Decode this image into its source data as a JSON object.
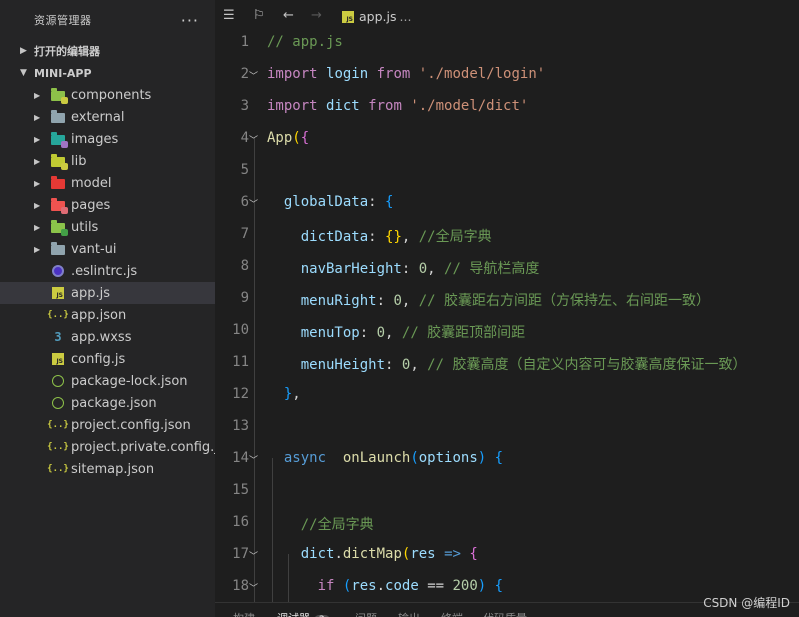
{
  "sidebar": {
    "title": "资源管理器",
    "more": "···",
    "open_editors": "打开的编辑器",
    "project": "MINI-APP",
    "items": [
      {
        "label": "components",
        "type": "folder",
        "color": "#8dc149",
        "dot": "#cbcb41"
      },
      {
        "label": "external",
        "type": "folder",
        "color": "#90a4ae",
        "dot": ""
      },
      {
        "label": "images",
        "type": "folder",
        "color": "#26a69a",
        "dot": "#a074c4"
      },
      {
        "label": "lib",
        "type": "folder",
        "color": "#c0ca33",
        "dot": "#cbcb41"
      },
      {
        "label": "model",
        "type": "folder",
        "color": "#e53935",
        "dot": ""
      },
      {
        "label": "pages",
        "type": "folder",
        "color": "#ef5350",
        "dot": "#e06c75"
      },
      {
        "label": "utils",
        "type": "folder",
        "color": "#8bc34a",
        "dot": "#43a047"
      },
      {
        "label": "vant-ui",
        "type": "folder",
        "color": "#90a4ae",
        "dot": ""
      },
      {
        "label": ".eslintrc.js",
        "type": "eslint"
      },
      {
        "label": "app.js",
        "type": "js",
        "selected": true
      },
      {
        "label": "app.json",
        "type": "json"
      },
      {
        "label": "app.wxss",
        "type": "wxss"
      },
      {
        "label": "config.js",
        "type": "js"
      },
      {
        "label": "package-lock.json",
        "type": "npm"
      },
      {
        "label": "package.json",
        "type": "npm"
      },
      {
        "label": "project.config.json",
        "type": "json"
      },
      {
        "label": "project.private.config.js...",
        "type": "json"
      },
      {
        "label": "sitemap.json",
        "type": "json"
      }
    ]
  },
  "breadcrumb": {
    "file": "app.js",
    "ellipsis": "..."
  },
  "code_lines": [
    {
      "n": "1",
      "fold": false,
      "tokens": [
        [
          "t-cmt",
          "// app.js"
        ]
      ]
    },
    {
      "n": "2",
      "fold": true,
      "tokens": [
        [
          "t-kw2",
          "import"
        ],
        [
          "t-pun",
          " "
        ],
        [
          "t-var",
          "login"
        ],
        [
          "t-pun",
          " "
        ],
        [
          "t-kw2",
          "from"
        ],
        [
          "t-pun",
          " "
        ],
        [
          "t-str",
          "'./model/login'"
        ]
      ]
    },
    {
      "n": "3",
      "fold": false,
      "tokens": [
        [
          "t-kw2",
          "import"
        ],
        [
          "t-pun",
          " "
        ],
        [
          "t-var",
          "dict"
        ],
        [
          "t-pun",
          " "
        ],
        [
          "t-kw2",
          "from"
        ],
        [
          "t-pun",
          " "
        ],
        [
          "t-str",
          "'./model/dict'"
        ]
      ]
    },
    {
      "n": "4",
      "fold": true,
      "tokens": [
        [
          "t-fn",
          "App"
        ],
        [
          "t-brk1",
          "("
        ],
        [
          "t-brk2",
          "{"
        ]
      ]
    },
    {
      "n": "5",
      "fold": false,
      "tokens": []
    },
    {
      "n": "6",
      "fold": true,
      "tokens": [
        [
          "t-pun",
          "  "
        ],
        [
          "t-var",
          "globalData"
        ],
        [
          "t-pun",
          ": "
        ],
        [
          "t-brk3",
          "{"
        ]
      ]
    },
    {
      "n": "7",
      "fold": false,
      "tokens": [
        [
          "t-pun",
          "    "
        ],
        [
          "t-var",
          "dictData"
        ],
        [
          "t-pun",
          ": "
        ],
        [
          "t-brk1",
          "{}"
        ],
        [
          "t-pun",
          ", "
        ],
        [
          "t-cmt",
          "//全局字典"
        ]
      ]
    },
    {
      "n": "8",
      "fold": false,
      "tokens": [
        [
          "t-pun",
          "    "
        ],
        [
          "t-var",
          "navBarHeight"
        ],
        [
          "t-pun",
          ": "
        ],
        [
          "t-num",
          "0"
        ],
        [
          "t-pun",
          ", "
        ],
        [
          "t-cmt",
          "// 导航栏高度"
        ]
      ]
    },
    {
      "n": "9",
      "fold": false,
      "tokens": [
        [
          "t-pun",
          "    "
        ],
        [
          "t-var",
          "menuRight"
        ],
        [
          "t-pun",
          ": "
        ],
        [
          "t-num",
          "0"
        ],
        [
          "t-pun",
          ", "
        ],
        [
          "t-cmt",
          "// 胶囊距右方间距（方保持左、右间距一致）"
        ]
      ]
    },
    {
      "n": "10",
      "fold": false,
      "tokens": [
        [
          "t-pun",
          "    "
        ],
        [
          "t-var",
          "menuTop"
        ],
        [
          "t-pun",
          ": "
        ],
        [
          "t-num",
          "0"
        ],
        [
          "t-pun",
          ", "
        ],
        [
          "t-cmt",
          "// 胶囊距顶部间距"
        ]
      ]
    },
    {
      "n": "11",
      "fold": false,
      "tokens": [
        [
          "t-pun",
          "    "
        ],
        [
          "t-var",
          "menuHeight"
        ],
        [
          "t-pun",
          ": "
        ],
        [
          "t-num",
          "0"
        ],
        [
          "t-pun",
          ", "
        ],
        [
          "t-cmt",
          "// 胶囊高度（自定义内容可与胶囊高度保证一致）"
        ]
      ]
    },
    {
      "n": "12",
      "fold": false,
      "tokens": [
        [
          "t-pun",
          "  "
        ],
        [
          "t-brk3",
          "}"
        ],
        [
          "t-pun",
          ","
        ]
      ]
    },
    {
      "n": "13",
      "fold": false,
      "tokens": []
    },
    {
      "n": "14",
      "fold": true,
      "tokens": [
        [
          "t-pun",
          "  "
        ],
        [
          "t-kw",
          "async"
        ],
        [
          "t-pun",
          "  "
        ],
        [
          "t-fn",
          "onLaunch"
        ],
        [
          "t-brk3",
          "("
        ],
        [
          "t-var",
          "options"
        ],
        [
          "t-brk3",
          ")"
        ],
        [
          "t-pun",
          " "
        ],
        [
          "t-brk3",
          "{"
        ]
      ]
    },
    {
      "n": "15",
      "fold": false,
      "tokens": []
    },
    {
      "n": "16",
      "fold": false,
      "tokens": [
        [
          "t-pun",
          "    "
        ],
        [
          "t-cmt",
          "//全局字典"
        ]
      ]
    },
    {
      "n": "17",
      "fold": true,
      "tokens": [
        [
          "t-pun",
          "    "
        ],
        [
          "t-var",
          "dict"
        ],
        [
          "t-pun",
          "."
        ],
        [
          "t-fn",
          "dictMap"
        ],
        [
          "t-brk1",
          "("
        ],
        [
          "t-var",
          "res"
        ],
        [
          "t-pun",
          " "
        ],
        [
          "t-kw",
          "=>"
        ],
        [
          "t-pun",
          " "
        ],
        [
          "t-brk2",
          "{"
        ]
      ]
    },
    {
      "n": "18",
      "fold": true,
      "tokens": [
        [
          "t-pun",
          "      "
        ],
        [
          "t-kw2",
          "if"
        ],
        [
          "t-pun",
          " "
        ],
        [
          "t-brk3",
          "("
        ],
        [
          "t-var",
          "res"
        ],
        [
          "t-pun",
          "."
        ],
        [
          "t-var",
          "code"
        ],
        [
          "t-pun",
          " == "
        ],
        [
          "t-num",
          "200"
        ],
        [
          "t-brk3",
          ")"
        ],
        [
          "t-pun",
          " "
        ],
        [
          "t-brk3",
          "{"
        ]
      ]
    }
  ],
  "panel": {
    "tabs": [
      {
        "label": "构建",
        "active": false
      },
      {
        "label": "调试器",
        "active": true,
        "badge": "2"
      },
      {
        "label": "问题",
        "active": false
      },
      {
        "label": "输出",
        "active": false
      },
      {
        "label": "终端",
        "active": false
      },
      {
        "label": "代码质量",
        "active": false
      }
    ]
  },
  "watermark": "CSDN @编程ID",
  "colors": {
    "background": "#1e1e1e",
    "sidebar": "#252526",
    "selection": "#37373d"
  }
}
